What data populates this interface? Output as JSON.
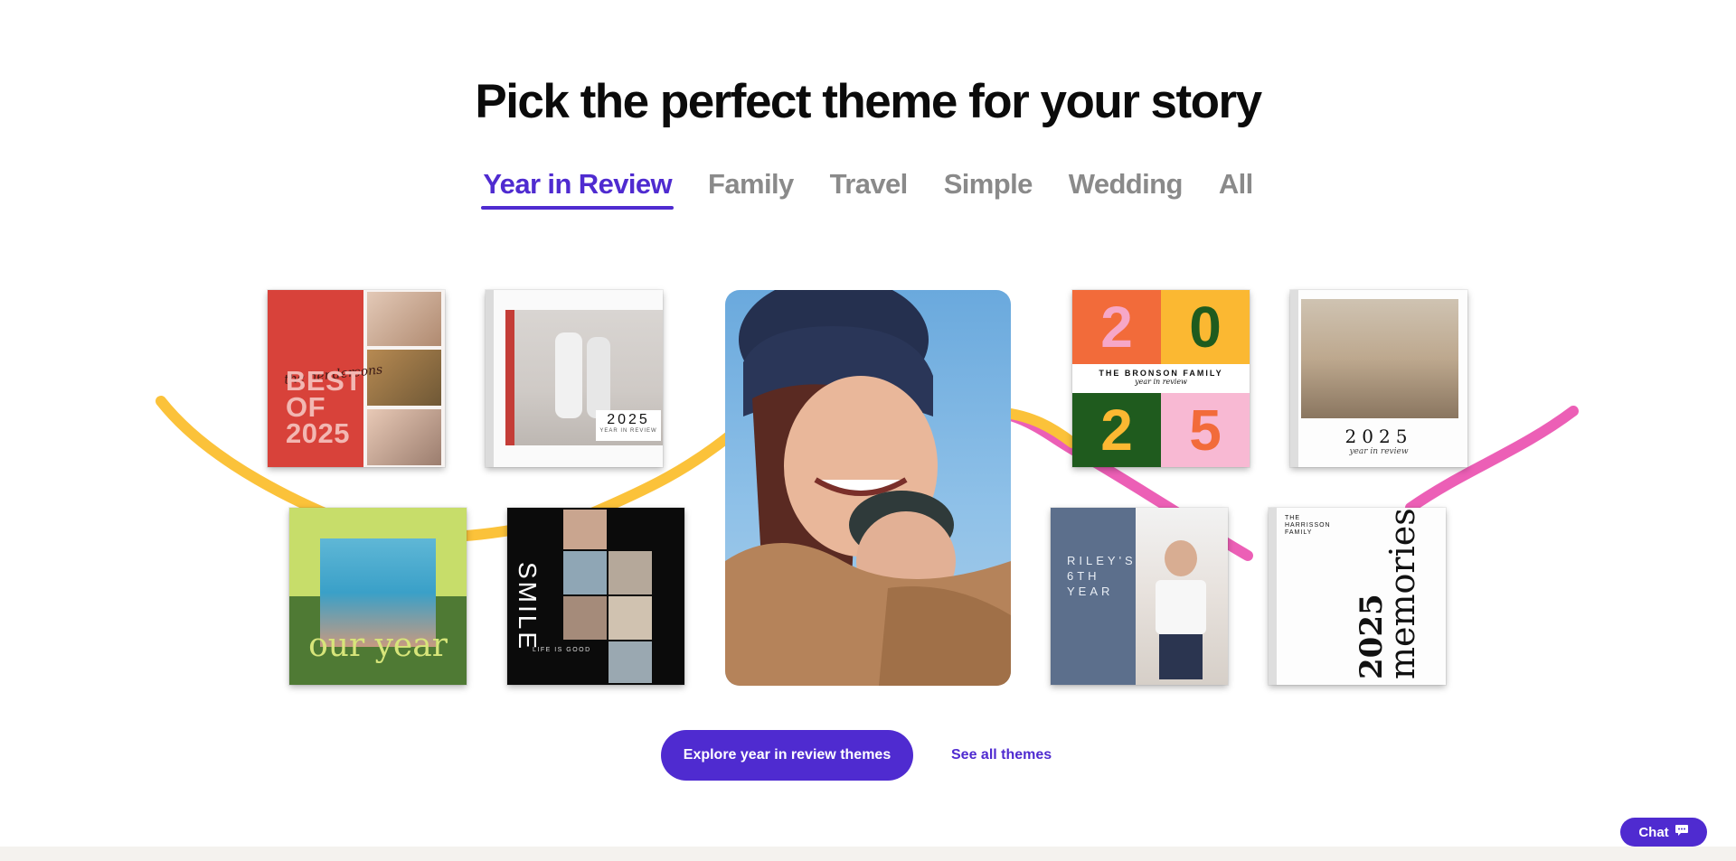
{
  "page": {
    "title": "Pick the perfect theme for your story"
  },
  "tabs": [
    {
      "label": "Year in Review",
      "active": true
    },
    {
      "label": "Family",
      "active": false
    },
    {
      "label": "Travel",
      "active": false
    },
    {
      "label": "Simple",
      "active": false
    },
    {
      "label": "Wedding",
      "active": false
    },
    {
      "label": "All",
      "active": false
    }
  ],
  "books": {
    "best_of": {
      "script": "the hendersons",
      "line1": "BEST",
      "line2": "OF",
      "line3": "2025"
    },
    "white_review": {
      "year": "2025",
      "subtitle": "YEAR IN REVIEW"
    },
    "color_grid": {
      "digits": [
        "2",
        "0",
        "2",
        "5"
      ],
      "family": "THE BRONSON FAMILY",
      "subtitle": "year in review"
    },
    "photo_year": {
      "year": "2025",
      "subtitle": "year in review"
    },
    "our_year": {
      "title": "our year"
    },
    "smile": {
      "title": "SMILE",
      "subtitle": "LIFE IS GOOD"
    },
    "riley": {
      "line1": "RILEY'S",
      "line2": "6TH",
      "line3": "YEAR"
    },
    "memories": {
      "family_line1": "THE",
      "family_line2": "HARRISSON",
      "family_line3": "FAMILY",
      "year": "2025",
      "word": "memories"
    }
  },
  "cta": {
    "primary_label": "Explore year in review themes",
    "secondary_label": "See all themes"
  },
  "chat": {
    "label": "Chat"
  },
  "colors": {
    "accent": "#4f2bd0",
    "squiggle_yellow": "#fbc23a",
    "squiggle_pink": "#ec5fb6",
    "tab_inactive": "#8a8a8a"
  }
}
